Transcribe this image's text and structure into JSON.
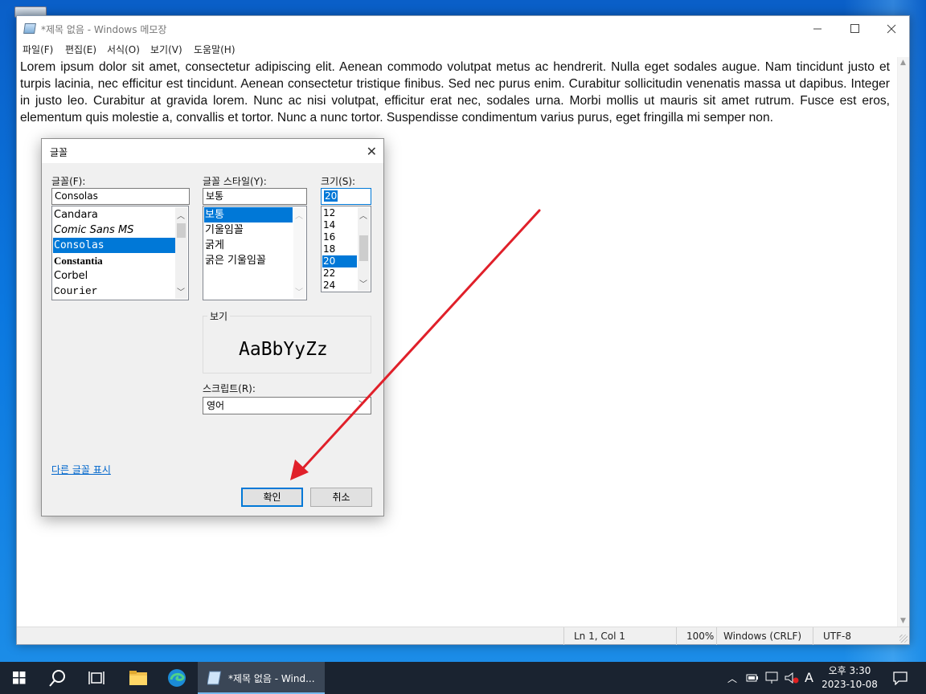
{
  "notepad": {
    "title": "*제목 없음 - Windows 메모장",
    "menu": [
      "파일(F)",
      "편집(E)",
      "서식(O)",
      "보기(V)",
      "도움말(H)"
    ],
    "body_text": "Lorem ipsum dolor sit amet, consectetur adipiscing elit. Aenean commodo volutpat metus ac hendrerit. Nulla eget sodales augue. Nam tincidunt justo et turpis lacinia, nec efficitur est tincidunt. Aenean consectetur tristique finibus. Sed nec purus enim. Curabitur sollicitudin venenatis massa ut dapibus. Integer in justo leo. Curabitur at gravida lorem. Nunc ac nisi volutpat, efficitur erat nec, sodales urna. Morbi mollis ut mauris sit amet rutrum. Fusce est eros, elementum quis molestie a, convallis et tortor. Nunc a nunc tortor. Suspendisse condimentum varius purus, eget fringilla mi semper non.",
    "status": {
      "position": "Ln 1, Col 1",
      "zoom": "100%",
      "line_ending": "Windows (CRLF)",
      "encoding": "UTF-8"
    }
  },
  "font_dialog": {
    "title": "글꼴",
    "font_label": "글꼴(F):",
    "font_value": "Consolas",
    "fonts": [
      "Candara",
      "Comic Sans MS",
      "Consolas",
      "Constantia",
      "Corbel",
      "Courier"
    ],
    "font_selected": "Consolas",
    "style_label": "글꼴 스타일(Y):",
    "style_value": "보통",
    "styles": [
      "보통",
      "기울임꼴",
      "굵게",
      "굵은 기울임꼴"
    ],
    "style_selected": "보통",
    "size_label": "크기(S):",
    "size_value": "20",
    "sizes": [
      "12",
      "14",
      "16",
      "18",
      "20",
      "22",
      "24"
    ],
    "size_selected": "20",
    "preview_label": "보기",
    "preview_text": "AaBbYyZz",
    "script_label": "스크립트(R):",
    "script_value": "영어",
    "more_fonts_link": "다른 글꼴 표시",
    "ok_button": "확인",
    "cancel_button": "취소"
  },
  "taskbar": {
    "active_app_label": "*제목 없음 - Wind...",
    "time": "오후 3:30",
    "date": "2023-10-08",
    "ime_indicator": "A"
  },
  "colors": {
    "accent": "#0078d7",
    "annotation_arrow": "#e0202a",
    "taskbar": "#1a2330"
  }
}
